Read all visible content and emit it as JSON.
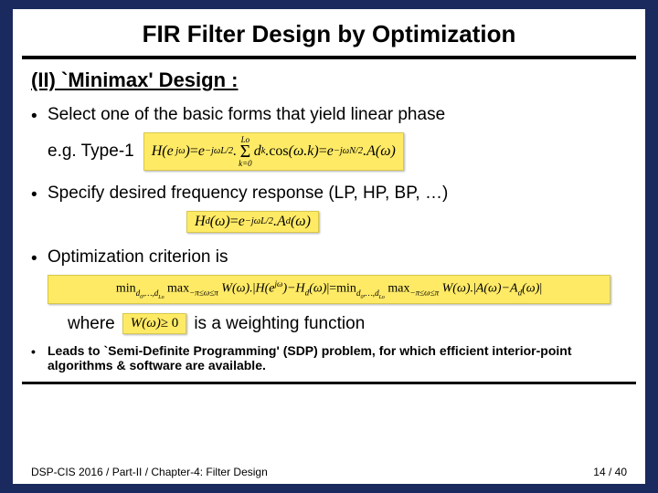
{
  "title": "FIR Filter Design by Optimization",
  "subtitle": "(II) `Minimax' Design :",
  "bullets": {
    "b1": "Select one of the basic forms that yield linear phase",
    "b1_eg": "e.g. Type-1",
    "b2": "Specify desired frequency response (LP, HP, BP, …)",
    "b3": "Optimization criterion is",
    "b4": "Leads to  `Semi-Definite Programming' (SDP) problem, for which efficient interior-point algorithms & software are available."
  },
  "where": {
    "pre": "where",
    "post": "is a weighting function"
  },
  "equations": {
    "type1": "H(e^{jω}) = e^{−jωL/2} · Σ_{k=0}^{Lo} d_k · cos(ω.k) = e^{−jωN/2} · A(ω)",
    "hd": "H_d(ω) = e^{−jωL/2} · A_d(ω)",
    "minimax": "min_{d_0,…,d_{Lo}} max_{−π≤ω≤π} W(ω) · |H(e^{jω}) − H_d(ω)| = min_{d_0,…,d_{Lo}} max_{−π≤ω≤π} W(ω) · |A(ω) − A_d(ω)|",
    "weight": "W(ω) ≥ 0"
  },
  "footer": {
    "left": "DSP-CIS 2016  /  Part-II  /  Chapter-4: Filter Design",
    "right": "14 / 40"
  },
  "chart_data": {
    "type": "table",
    "note": "presentation slide, no quantitative chart data",
    "slide_number": 14,
    "total_slides": 40
  }
}
